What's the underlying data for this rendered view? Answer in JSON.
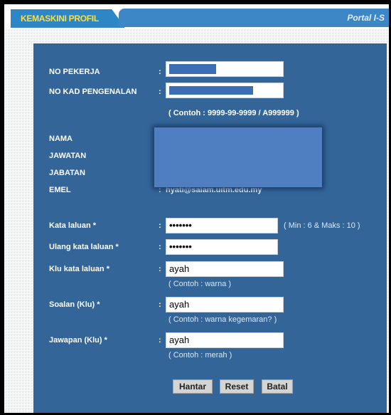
{
  "header": {
    "tab_label": "KEMASKINI PROFIL",
    "portal_label": "Portal I-S"
  },
  "form": {
    "no_pekerja": {
      "label": "NO PEKERJA",
      "value": ""
    },
    "no_kad": {
      "label": "NO KAD PENGENALAN",
      "value": "",
      "hint": "( Contoh : 9999-99-9999 / A999999 )"
    },
    "nama": {
      "label": "NAMA"
    },
    "jawatan": {
      "label": "JAWATAN"
    },
    "jabatan": {
      "label": "JABATAN"
    },
    "emel": {
      "label": "EMEL",
      "value": "hyati@salam.uitm.edu.my"
    },
    "kata_laluan": {
      "label": "Kata laluan *",
      "value": "•••••••",
      "hint": "( Min : 6 & Maks : 10 )"
    },
    "ulang_kata_laluan": {
      "label": "Ulang kata laluan *",
      "value": "•••••••"
    },
    "klu_kata_laluan": {
      "label": "Klu kata laluan *",
      "value": "ayah",
      "hint": "( Contoh : warna )"
    },
    "soalan": {
      "label": "Soalan (Klu) *",
      "value": "ayah",
      "hint": "( Contoh : warna kegemaran? )"
    },
    "jawapan": {
      "label": "Jawapan (Klu) *",
      "value": "ayah",
      "hint": "( Contoh : merah )"
    },
    "colon": ":"
  },
  "buttons": {
    "submit": "Hantar",
    "reset": "Reset",
    "cancel": "Batal"
  }
}
